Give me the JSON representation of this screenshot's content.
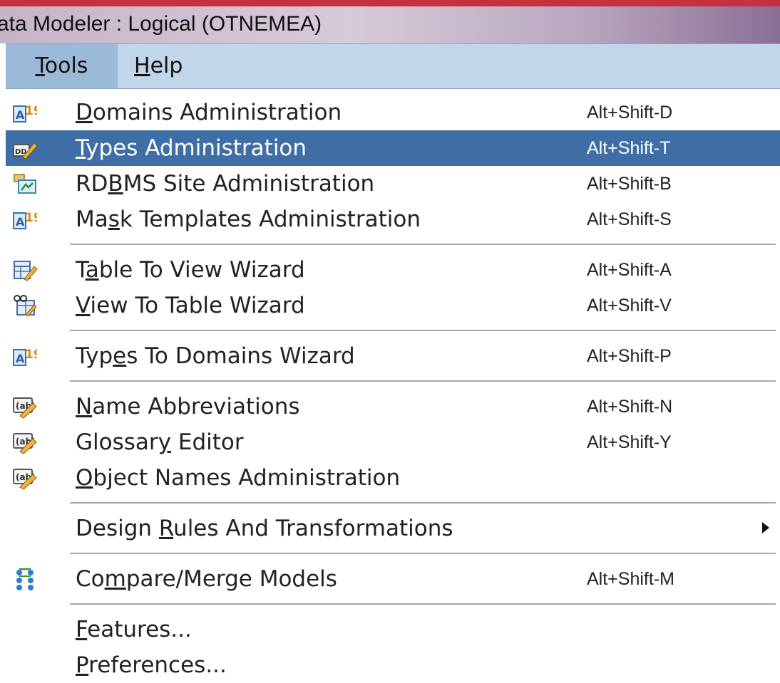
{
  "window": {
    "title": "ata Modeler : Logical (OTNEMEA)"
  },
  "menubar": [
    {
      "label_pre": "",
      "label_ul": "T",
      "label_post": "ools"
    },
    {
      "label_pre": "",
      "label_ul": "H",
      "label_post": "elp"
    }
  ],
  "menu": {
    "items": [
      {
        "pre": "",
        "ul": "D",
        "post": "omains Administration",
        "shortcut": "Alt+Shift-D",
        "icon": "a19-icon"
      },
      {
        "pre": "",
        "ul": "T",
        "post": "ypes Administration",
        "shortcut": "Alt+Shift-T",
        "icon": "types-edit-icon",
        "highlighted": true
      },
      {
        "pre": "RD",
        "ul": "B",
        "post": "MS Site Administration",
        "shortcut": "Alt+Shift-B",
        "icon": "rdbms-site-icon"
      },
      {
        "pre": "Ma",
        "ul": "s",
        "post": "k Templates Administration",
        "shortcut": "Alt+Shift-S",
        "icon": "a19-icon"
      },
      {
        "pre": "T",
        "ul": "a",
        "post": "ble To View Wizard",
        "shortcut": "Alt+Shift-A",
        "icon": "table-view-icon"
      },
      {
        "pre": "",
        "ul": "V",
        "post": "iew To Table Wizard",
        "shortcut": "Alt+Shift-V",
        "icon": "view-table-icon"
      },
      {
        "pre": "Typ",
        "ul": "e",
        "post": "s To Domains Wizard",
        "shortcut": "Alt+Shift-P",
        "icon": "a19-icon"
      },
      {
        "pre": "",
        "ul": "N",
        "post": "ame Abbreviations",
        "shortcut": "Alt+Shift-N",
        "icon": "ab-pencil-icon"
      },
      {
        "pre": "Glossar",
        "ul": "y",
        "post": " Editor",
        "shortcut": "Alt+Shift-Y",
        "icon": "ab-pencil-icon"
      },
      {
        "pre": "",
        "ul": "O",
        "post": "bject Names Administration",
        "shortcut": "",
        "icon": "ab-pencil-icon"
      },
      {
        "pre": "Design ",
        "ul": "R",
        "post": "ules And Transformations",
        "shortcut": "",
        "icon": "",
        "submenu": true
      },
      {
        "pre": "Co",
        "ul": "m",
        "post": "pare/Merge Models",
        "shortcut": "Alt+Shift-M",
        "icon": "compare-merge-icon"
      },
      {
        "pre": "",
        "ul": "F",
        "post": "eatures...",
        "shortcut": "",
        "icon": ""
      },
      {
        "pre": "",
        "ul": "P",
        "post": "references...",
        "shortcut": "",
        "icon": ""
      }
    ]
  }
}
